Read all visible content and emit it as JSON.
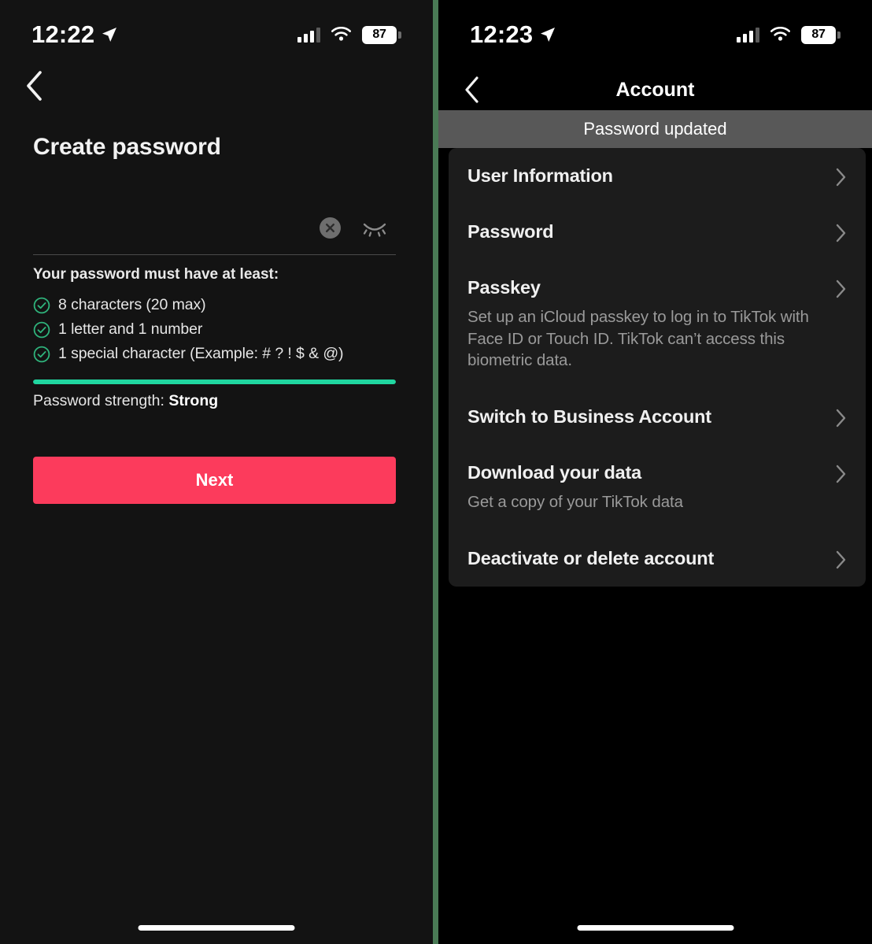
{
  "colors": {
    "accent_red": "#FC3B5C",
    "strength_green": "#20D6A0",
    "divider_green": "#4A7A55",
    "card_bg": "#1C1C1C",
    "toast_bg": "#585858"
  },
  "left_panel": {
    "status_bar": {
      "time": "12:22",
      "location_icon": "location-arrow-icon",
      "signal_icon": "cellular-signal-icon",
      "signal_bars_filled": 3,
      "signal_bars_total": 4,
      "wifi_icon": "wifi-icon",
      "battery_level": "87"
    },
    "back_icon": "chevron-left-icon",
    "title": "Create password",
    "password_field": {
      "value": "",
      "placeholder": "",
      "clear_icon": "clear-circle-x-icon",
      "visibility_icon": "eye-closed-icon"
    },
    "requirements_heading": "Your password must have at least:",
    "requirements": [
      {
        "text": "8 characters (20 max)",
        "met": true,
        "icon": "check-circle-icon"
      },
      {
        "text": "1 letter and 1 number",
        "met": true,
        "icon": "check-circle-icon"
      },
      {
        "text": "1 special character (Example: # ? ! $ & @)",
        "met": true,
        "icon": "check-circle-icon"
      }
    ],
    "strength": {
      "label_prefix": "Password strength: ",
      "value": "Strong",
      "percent": 100
    },
    "next_button": "Next",
    "home_indicator": "home-indicator"
  },
  "right_panel": {
    "status_bar": {
      "time": "12:23",
      "location_icon": "location-arrow-icon",
      "signal_icon": "cellular-signal-icon",
      "signal_bars_filled": 3,
      "signal_bars_total": 4,
      "wifi_icon": "wifi-icon",
      "battery_level": "87"
    },
    "nav": {
      "back_icon": "chevron-left-icon",
      "title": "Account"
    },
    "toast": "Password updated",
    "settings_rows": [
      {
        "label": "User Information",
        "sub": "",
        "chevron": "chevron-right-icon"
      },
      {
        "label": "Password",
        "sub": "",
        "chevron": "chevron-right-icon"
      },
      {
        "label": "Passkey",
        "sub": "Set up an iCloud passkey to log in to TikTok with Face ID or Touch ID. TikTok can’t access this biometric data.",
        "chevron": "chevron-right-icon"
      },
      {
        "label": "Switch to Business Account",
        "sub": "",
        "chevron": "chevron-right-icon"
      },
      {
        "label": "Download your data",
        "sub": "Get a copy of your TikTok data",
        "chevron": "chevron-right-icon"
      },
      {
        "label": "Deactivate or delete account",
        "sub": "",
        "chevron": "chevron-right-icon"
      }
    ],
    "home_indicator": "home-indicator"
  }
}
